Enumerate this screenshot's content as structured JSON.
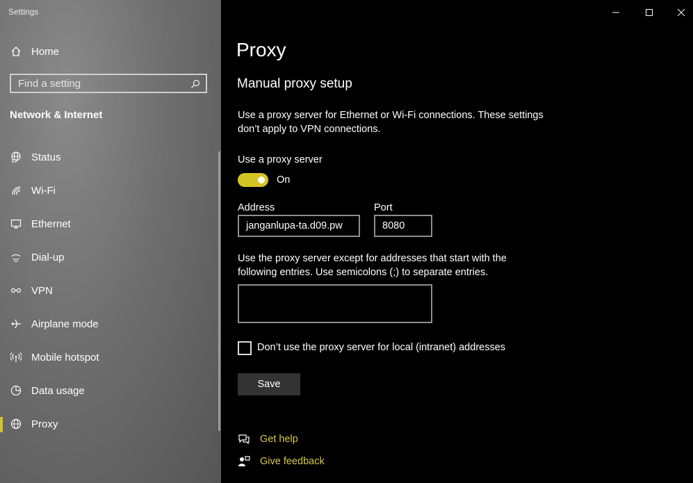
{
  "window": {
    "app_title": "Settings",
    "controls": [
      "minimize",
      "maximize",
      "close"
    ]
  },
  "sidebar": {
    "home_label": "Home",
    "search_placeholder": "Find a setting",
    "section_title": "Network & Internet",
    "items": [
      {
        "label": "Status",
        "icon": "globe-network-icon"
      },
      {
        "label": "Wi-Fi",
        "icon": "wifi-icon"
      },
      {
        "label": "Ethernet",
        "icon": "ethernet-icon"
      },
      {
        "label": "Dial-up",
        "icon": "dialup-icon"
      },
      {
        "label": "VPN",
        "icon": "vpn-icon"
      },
      {
        "label": "Airplane mode",
        "icon": "airplane-icon"
      },
      {
        "label": "Mobile hotspot",
        "icon": "hotspot-icon"
      },
      {
        "label": "Data usage",
        "icon": "data-usage-icon"
      },
      {
        "label": "Proxy",
        "icon": "globe-icon",
        "selected": true
      }
    ]
  },
  "main": {
    "page_title": "Proxy",
    "section_title": "Manual proxy setup",
    "description": "Use a proxy server for Ethernet or Wi-Fi connections. These settings don’t apply to VPN connections.",
    "use_proxy_label": "Use a proxy server",
    "toggle_state": "On",
    "toggle_on": true,
    "address_label": "Address",
    "address_value": "janganlupa-ta.d09.pw",
    "port_label": "Port",
    "port_value": "8080",
    "exceptions_description": "Use the proxy server except for addresses that start with the following entries. Use semicolons (;) to separate entries.",
    "exceptions_value": "",
    "local_checkbox_label": "Don’t use the proxy server for local (intranet) addresses",
    "local_checkbox_checked": false,
    "save_label": "Save",
    "links": {
      "get_help": "Get help",
      "give_feedback": "Give feedback"
    }
  },
  "colors": {
    "accent": "#d4c524",
    "link": "#d8c84a",
    "background": "#000000"
  }
}
